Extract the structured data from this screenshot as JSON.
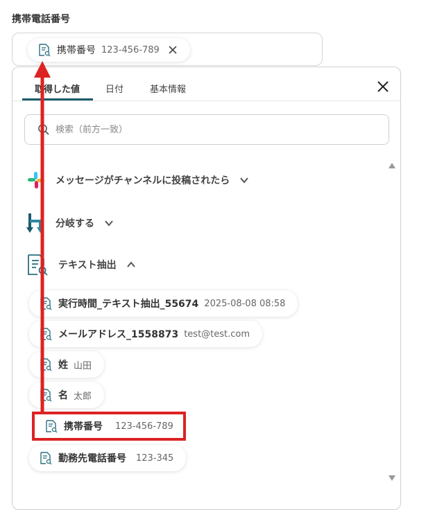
{
  "field": {
    "label": "携帯電話番号",
    "chip": {
      "label": "携帯番号",
      "value": "123-456-789"
    }
  },
  "tabs": [
    {
      "label": "取得した値",
      "active": true
    },
    {
      "label": "日付",
      "active": false
    },
    {
      "label": "基本情報",
      "active": false
    }
  ],
  "search": {
    "placeholder": "検索（前方一致）",
    "value": ""
  },
  "sections": [
    {
      "name": "メッセージがチャンネルに投稿されたら",
      "icon": "slack-icon",
      "expanded": false
    },
    {
      "name": "分岐する",
      "icon": "branch-icon",
      "expanded": false
    },
    {
      "name": "テキスト抽出",
      "icon": "text-extract-icon",
      "expanded": true
    }
  ],
  "items": [
    {
      "label": "実行時間_テキスト抽出_55674",
      "value": "2025-08-08 08:58"
    },
    {
      "label": "メールアドレス_1558873",
      "value": "test@test.com"
    },
    {
      "label": "姓",
      "value": "山田"
    },
    {
      "label": "名",
      "value": "太郎"
    },
    {
      "label": "携帯番号",
      "value": "123-456-789"
    },
    {
      "label": "勤務先電話番号",
      "value": "123-345"
    }
  ],
  "colors": {
    "accent": "#1b5a6b",
    "highlight": "#dd2222",
    "icon_teal": "#2a6f80"
  }
}
